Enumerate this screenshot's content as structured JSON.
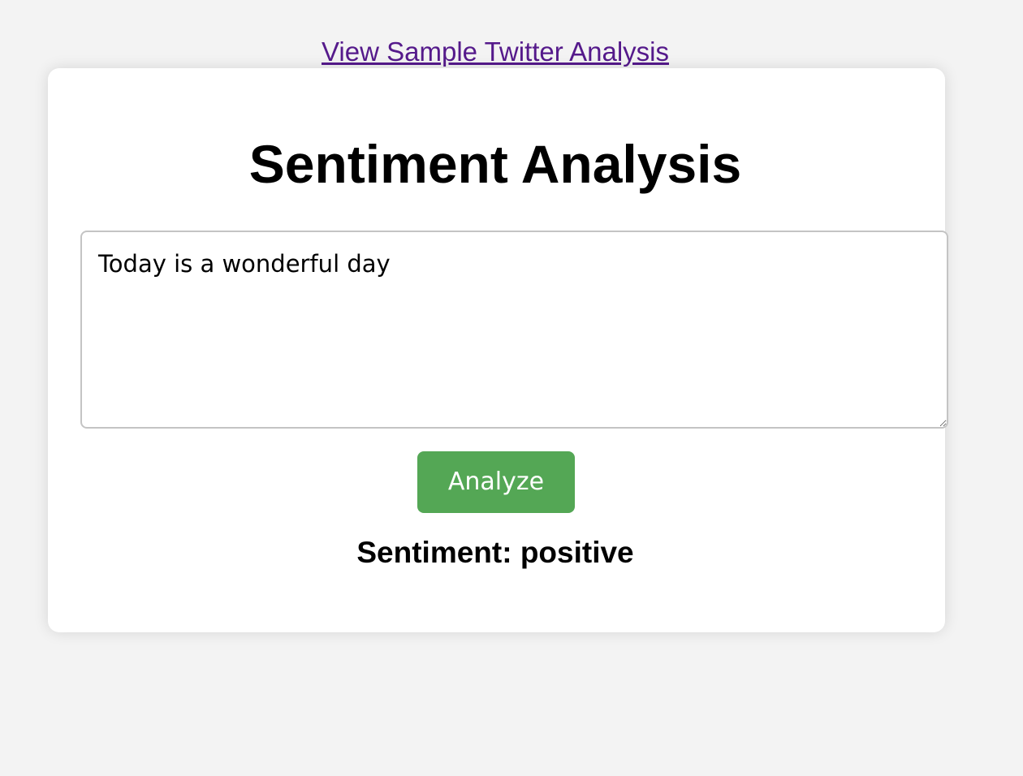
{
  "header": {
    "sample_link_label": "View Sample Twitter Analysis"
  },
  "card": {
    "title": "Sentiment Analysis",
    "input": {
      "value": "Today is a wonderful day",
      "placeholder": ""
    },
    "analyze_button_label": "Analyze",
    "result_text": "Sentiment: positive"
  },
  "colors": {
    "background": "#f3f3f3",
    "card": "#ffffff",
    "link": "#551a8b",
    "button": "#54a755",
    "button_text": "#ffffff"
  }
}
